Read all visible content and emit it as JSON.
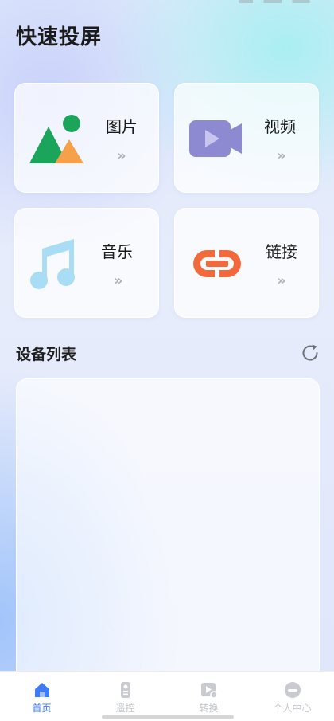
{
  "page_title": "快速投屏",
  "cards": [
    {
      "label": "图片",
      "chevron": "»",
      "icon": "image-icon"
    },
    {
      "label": "视频",
      "chevron": "»",
      "icon": "video-camera-icon"
    },
    {
      "label": "音乐",
      "chevron": "»",
      "icon": "music-note-icon"
    },
    {
      "label": "链接",
      "chevron": "»",
      "icon": "link-icon"
    }
  ],
  "device_section": {
    "title": "设备列表",
    "refresh_icon": "refresh-icon"
  },
  "tabbar": {
    "items": [
      {
        "label": "首页",
        "icon": "home-icon",
        "active": true
      },
      {
        "label": "遥控",
        "icon": "remote-control-icon",
        "active": false
      },
      {
        "label": "转换",
        "icon": "convert-video-icon",
        "active": false
      },
      {
        "label": "个人中心",
        "icon": "profile-icon",
        "active": false
      }
    ]
  },
  "colors": {
    "accent": "#3d7bf7",
    "image_green": "#1aa55b",
    "image_orange": "#f6a14a",
    "video_purple": "#8d8ad1",
    "music_blue": "#a9dcf5",
    "link_orange": "#f26a3c"
  }
}
